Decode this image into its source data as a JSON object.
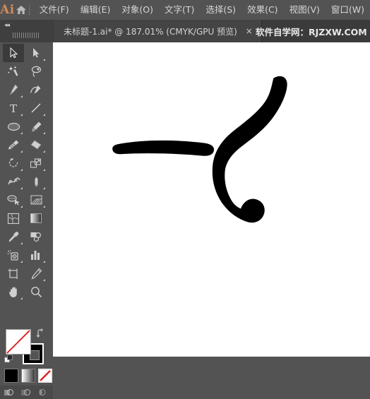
{
  "app": {
    "logo_text": "Ai",
    "brand_color": "#d08b5b",
    "chrome_color": "#535353",
    "tabbar_color": "#3b3b3b"
  },
  "menubar": {
    "home_icon": "home-icon",
    "items": [
      {
        "label": "文件(F)"
      },
      {
        "label": "编辑(E)"
      },
      {
        "label": "对象(O)"
      },
      {
        "label": "文字(T)"
      },
      {
        "label": "选择(S)"
      },
      {
        "label": "效果(C)"
      },
      {
        "label": "视图(V)"
      },
      {
        "label": "窗口(W)"
      }
    ]
  },
  "tabbar": {
    "collapse_arrows": "«",
    "document_tab": {
      "title": "未标题-1.ai* @ 187.01% (CMYK/GPU 预览)",
      "close_label": "×"
    },
    "watermark": "软件自学网：RJZXW.COM"
  },
  "toolpanel": {
    "tools": [
      {
        "name": "selection-tool",
        "label": "选择工具",
        "active": true,
        "has_flyout": false
      },
      {
        "name": "direct-selection-tool",
        "label": "直接选择工具",
        "active": false,
        "has_flyout": true
      },
      {
        "name": "magic-wand-tool",
        "label": "魔棒工具",
        "active": false,
        "has_flyout": false
      },
      {
        "name": "lasso-tool",
        "label": "套索工具",
        "active": false,
        "has_flyout": false
      },
      {
        "name": "pen-tool",
        "label": "钢笔工具",
        "active": false,
        "has_flyout": true
      },
      {
        "name": "curvature-tool",
        "label": "曲率工具",
        "active": false,
        "has_flyout": false
      },
      {
        "name": "type-tool",
        "label": "文字工具",
        "active": false,
        "has_flyout": true
      },
      {
        "name": "line-segment-tool",
        "label": "直线段工具",
        "active": false,
        "has_flyout": true
      },
      {
        "name": "ellipse-tool",
        "label": "椭圆工具",
        "active": false,
        "has_flyout": true
      },
      {
        "name": "paintbrush-tool",
        "label": "画笔工具",
        "active": false,
        "has_flyout": true
      },
      {
        "name": "pencil-tool",
        "label": "铅笔工具",
        "active": false,
        "has_flyout": true
      },
      {
        "name": "eraser-tool",
        "label": "橡皮擦工具",
        "active": false,
        "has_flyout": true
      },
      {
        "name": "rotate-tool",
        "label": "旋转工具",
        "active": false,
        "has_flyout": true
      },
      {
        "name": "scale-tool",
        "label": "比例缩放工具",
        "active": false,
        "has_flyout": true
      },
      {
        "name": "width-tool",
        "label": "宽度工具",
        "active": false,
        "has_flyout": true
      },
      {
        "name": "free-transform-tool",
        "label": "自由变换工具",
        "active": false,
        "has_flyout": false
      },
      {
        "name": "shape-builder-tool",
        "label": "形状生成器工具",
        "active": false,
        "has_flyout": true
      },
      {
        "name": "perspective-grid-tool",
        "label": "透视网格工具",
        "active": false,
        "has_flyout": true
      },
      {
        "name": "mesh-tool",
        "label": "网格工具",
        "active": false,
        "has_flyout": false
      },
      {
        "name": "gradient-tool",
        "label": "渐变工具",
        "active": false,
        "has_flyout": false
      },
      {
        "name": "eyedropper-tool",
        "label": "吸管工具",
        "active": false,
        "has_flyout": true
      },
      {
        "name": "blend-tool",
        "label": "混合工具",
        "active": false,
        "has_flyout": false
      },
      {
        "name": "symbol-sprayer-tool",
        "label": "符号喷枪工具",
        "active": false,
        "has_flyout": true
      },
      {
        "name": "column-graph-tool",
        "label": "柱形图工具",
        "active": false,
        "has_flyout": true
      },
      {
        "name": "artboard-tool",
        "label": "画板工具",
        "active": false,
        "has_flyout": false
      },
      {
        "name": "slice-tool",
        "label": "切片工具",
        "active": false,
        "has_flyout": true
      },
      {
        "name": "hand-tool",
        "label": "抓手工具",
        "active": false,
        "has_flyout": true
      },
      {
        "name": "zoom-tool",
        "label": "缩放工具",
        "active": false,
        "has_flyout": false
      }
    ],
    "fill_stroke": {
      "fill_name": "fill-swatch-none",
      "fill_value": "无",
      "fill_color": "#ffffff",
      "stroke_name": "stroke-swatch",
      "stroke_color": "#000000",
      "swap_icon": "swap-fill-stroke-icon",
      "default_icon": "default-fill-stroke-icon"
    },
    "color_modes": [
      {
        "name": "color-mode-button",
        "label": "颜色",
        "selected": false
      },
      {
        "name": "gradient-mode-button",
        "label": "渐变",
        "selected": false
      },
      {
        "name": "none-mode-button",
        "label": "无",
        "selected": true
      }
    ],
    "draw_modes": [
      {
        "name": "draw-normal-button",
        "label": "正常绘图"
      },
      {
        "name": "draw-behind-button",
        "label": "背后绘图"
      },
      {
        "name": "draw-inside-button",
        "label": "内部绘图"
      }
    ]
  },
  "canvas": {
    "background": "#ffffff",
    "artwork_color": "#000000",
    "strokes": [
      {
        "name": "horizontal-brush-stroke",
        "description": "横笔画"
      },
      {
        "name": "hook-brush-stroke",
        "description": "竖钩笔画"
      }
    ]
  }
}
